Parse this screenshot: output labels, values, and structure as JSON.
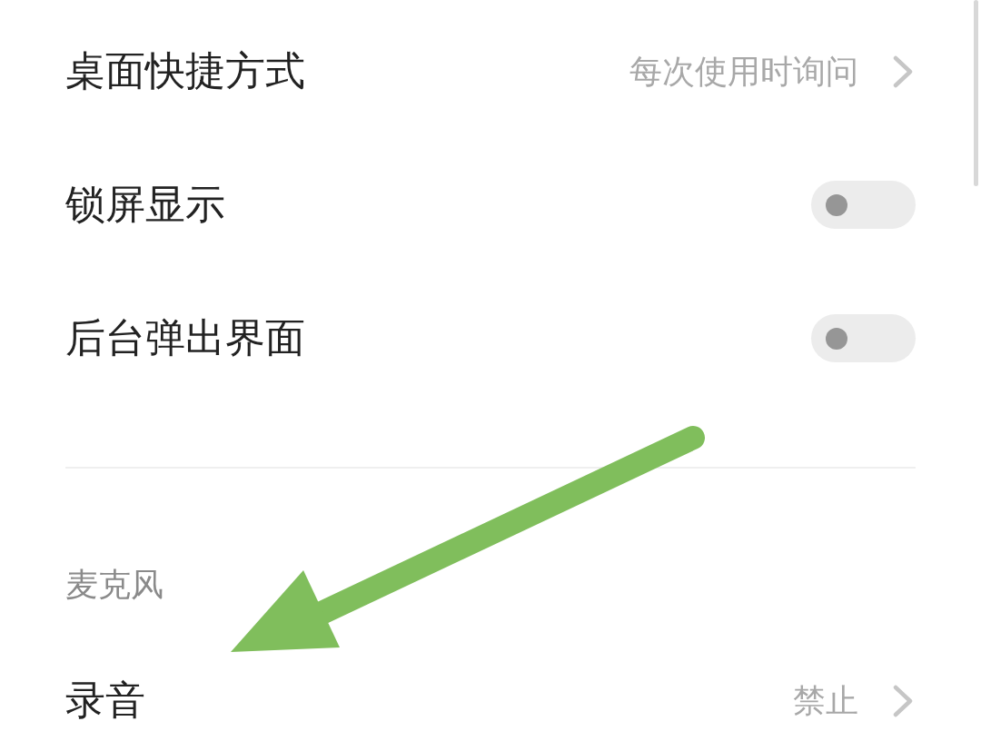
{
  "sections": [
    {
      "rows": [
        {
          "kind": "link",
          "label": "桌面快捷方式",
          "value": "每次使用时询问"
        },
        {
          "kind": "toggle",
          "label": "锁屏显示",
          "on": false
        },
        {
          "kind": "toggle",
          "label": "后台弹出界面",
          "on": false
        }
      ]
    },
    {
      "header": "麦克风",
      "rows": [
        {
          "kind": "link",
          "label": "录音",
          "value": "禁止"
        }
      ]
    }
  ]
}
